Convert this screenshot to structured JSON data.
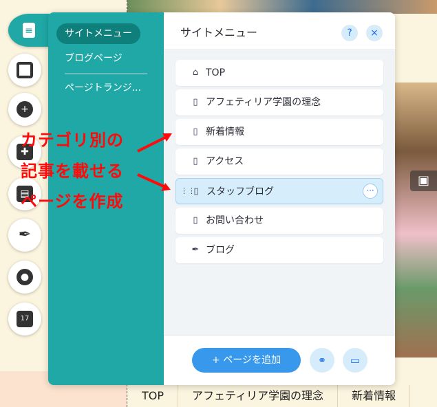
{
  "panel": {
    "side_menu": [
      {
        "label": "サイトメニュー",
        "active": true
      },
      {
        "label": "ブログページ",
        "active": false
      },
      {
        "label": "ページトランジ...",
        "active": false
      }
    ],
    "title": "サイトメニュー",
    "help_label": "?",
    "close_label": "×",
    "pages": [
      {
        "label": "TOP",
        "icon": "home-icon"
      },
      {
        "label": "アフェティリア学園の理念",
        "icon": "page-icon"
      },
      {
        "label": "新着情報",
        "icon": "page-icon"
      },
      {
        "label": "アクセス",
        "icon": "page-icon"
      },
      {
        "label": "スタッフブログ",
        "icon": "page-icon",
        "selected": true
      },
      {
        "label": "お問い合わせ",
        "icon": "page-icon"
      },
      {
        "label": "ブログ",
        "icon": "pen-icon"
      }
    ],
    "more_label": "···",
    "add_page_label": "+ ページを追加"
  },
  "bottom_nav": [
    "TOP",
    "アフェティリア学園の理念",
    "新着情報"
  ],
  "annotation": {
    "line1": "カテゴリ別の",
    "line2": "記事を載せる",
    "line3": "ページを作成",
    "color": "#ff0a0a"
  },
  "colors": {
    "teal": "#1fa8a6",
    "teal_dark": "#0f7f7c",
    "accent_blue": "#3899ec",
    "selected_row": "#d6eefc"
  }
}
